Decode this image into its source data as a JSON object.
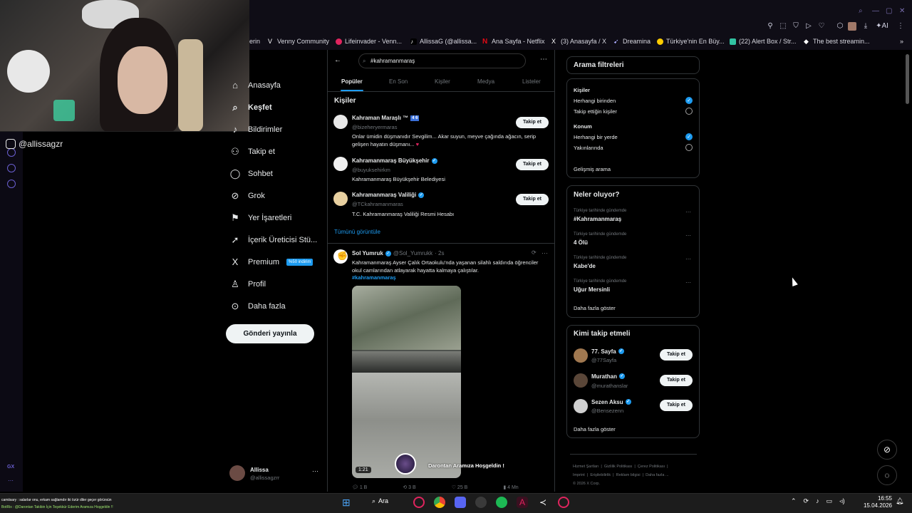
{
  "browser": {
    "bookmarks": [
      {
        "label": "erin",
        "color": "#1d9bf0"
      },
      {
        "label": "Venny Community",
        "color": "#ffffff"
      },
      {
        "label": "Lifeinvader - Venn...",
        "color": "#e0245e"
      },
      {
        "label": "AllissaG (@allissa...",
        "color": "#ffffff"
      },
      {
        "label": "Ana Sayfa - Netflix",
        "color": "#e50914"
      },
      {
        "label": "(3) Anasayfa / X",
        "color": "#ffffff"
      },
      {
        "label": "Dreamina",
        "color": "#aaaaff"
      },
      {
        "label": "Türkiye'nin En Büy...",
        "color": "#ffcc00"
      },
      {
        "label": "(22) Alert Box / Str...",
        "color": "#31c3a2"
      },
      {
        "label": "The best streamin...",
        "color": "#ffffff"
      }
    ],
    "ai_label": "AI"
  },
  "stream": {
    "handle": "@allissagzr"
  },
  "gx_label": "GX",
  "nav": {
    "items": [
      {
        "label": "Anasayfa",
        "icon": "home-icon"
      },
      {
        "label": "Keşfet",
        "icon": "search-icon"
      },
      {
        "label": "Bildirimler",
        "icon": "bell-icon"
      },
      {
        "label": "Takip et",
        "icon": "person-plus-icon"
      },
      {
        "label": "Sohbet",
        "icon": "chat-icon"
      },
      {
        "label": "Grok",
        "icon": "grok-icon"
      },
      {
        "label": "Yer İşaretleri",
        "icon": "bookmark-icon"
      },
      {
        "label": "İçerik Üreticisi Stü...",
        "icon": "rocket-icon"
      },
      {
        "label": "Premium",
        "icon": "x-logo-icon"
      },
      {
        "label": "Profil",
        "icon": "profile-icon"
      },
      {
        "label": "Daha fazla",
        "icon": "more-circle-icon"
      }
    ],
    "premium_badge": "%50 indirim",
    "post_button": "Gönderi yayınla",
    "account": {
      "name": "Allissa",
      "handle": "@allissagzrr"
    }
  },
  "search": {
    "query": "#kahramanmaraş",
    "tabs": [
      "Popüler",
      "En Son",
      "Kişiler",
      "Medya",
      "Listeler"
    ],
    "people_heading": "Kişiler",
    "people": [
      {
        "name": "Kahraman Maraşlı ™",
        "badge": "4 6",
        "handle": "@bizeheryermaras",
        "bio": "Onlar ümidin düşmanıdır Sevgilim... Akar suyun, meyve çağında ağacın, serip gelişen hayatın düşmanı...",
        "follow": "Takip et"
      },
      {
        "name": "Kahramanmaraş Büyükşehir",
        "handle": "@buyuksehirkm",
        "bio": "Kahramanmaraş Büyükşehir Belediyesi",
        "follow": "Takip et"
      },
      {
        "name": "Kahramanmaraş Valiliği",
        "handle": "@TCkahramanmaras",
        "bio": "T.C. Kahramanmaraş Valiliği Resmi Hesabı",
        "follow": "Takip et"
      }
    ],
    "show_all": "Tümünü görüntüle"
  },
  "tweet": {
    "name": "Sol Yumruk",
    "handle": "@Sol_Yumrukk",
    "time": "· 2s",
    "text": "Kahramanmaraş Ayser Çalık Ortaokulu'nda yaşanan silahlı saldırıda öğrenciler okul camlarından atlayarak hayatta kalmaya çalıştılar.",
    "hashtag": "#kahramanmaraş",
    "video_duration": "1:21",
    "overlay_text": "Darontan Aramıza Hoşgeldin !",
    "stats": {
      "replies": "1 B",
      "retweets": "3 B",
      "likes": "25 B",
      "views": "4 Mn"
    }
  },
  "filters": {
    "title": "Arama filtreleri",
    "people_label": "Kişiler",
    "people_options": [
      {
        "label": "Herhangi birinden",
        "selected": true
      },
      {
        "label": "Takip ettiğin kişiler",
        "selected": false
      }
    ],
    "location_label": "Konum",
    "location_options": [
      {
        "label": "Herhangi bir yerde",
        "selected": true
      },
      {
        "label": "Yakınlarında",
        "selected": false
      }
    ],
    "advanced": "Gelişmiş arama"
  },
  "trends": {
    "title": "Neler oluyor?",
    "items": [
      {
        "context": "Türkiye tarihinde gündemde",
        "name": "#Kahramanmaraş"
      },
      {
        "context": "Türkiye tarihinde gündemde",
        "name": "4 Ölü"
      },
      {
        "context": "Türkiye tarihinde gündemde",
        "name": "Kabe'de"
      },
      {
        "context": "Türkiye tarihinde gündemde",
        "name": "Uğur Mersinli"
      }
    ],
    "show_more": "Daha fazla göster"
  },
  "who_to_follow": {
    "title": "Kimi takip etmeli",
    "items": [
      {
        "name": "77. Sayfa",
        "handle": "@77Sayfa",
        "follow": "Takip et",
        "color": "#a07850"
      },
      {
        "name": "Murathan",
        "handle": "@murathanslar",
        "follow": "Takip et",
        "color": "#5a4638"
      },
      {
        "name": "Sezen Aksu",
        "handle": "@Bensezenn",
        "follow": "Takip et",
        "color": "#d0d0d0"
      }
    ],
    "show_more": "Daha fazla göster"
  },
  "footer": {
    "links": [
      "Hizmet Şartları",
      "Gizlilik Politikası",
      "Çerez Politikası",
      "Imprint",
      "Erişilebilirlik",
      "Reklam bilgisi",
      "Daha fazla ..."
    ],
    "copyright": "© 2026 X Corp."
  },
  "chat": {
    "line1": "camiisary : salarlar onu, erkam sağlamdır iki özür diler geçer görürsün",
    "line2": "BotRix : @Darontan Takibin İçin Teşekkür Ederim Aramıza Hoşgeldin !!"
  },
  "taskbar": {
    "search": "Ara",
    "time": "16:55",
    "date": "15.04.2026"
  }
}
